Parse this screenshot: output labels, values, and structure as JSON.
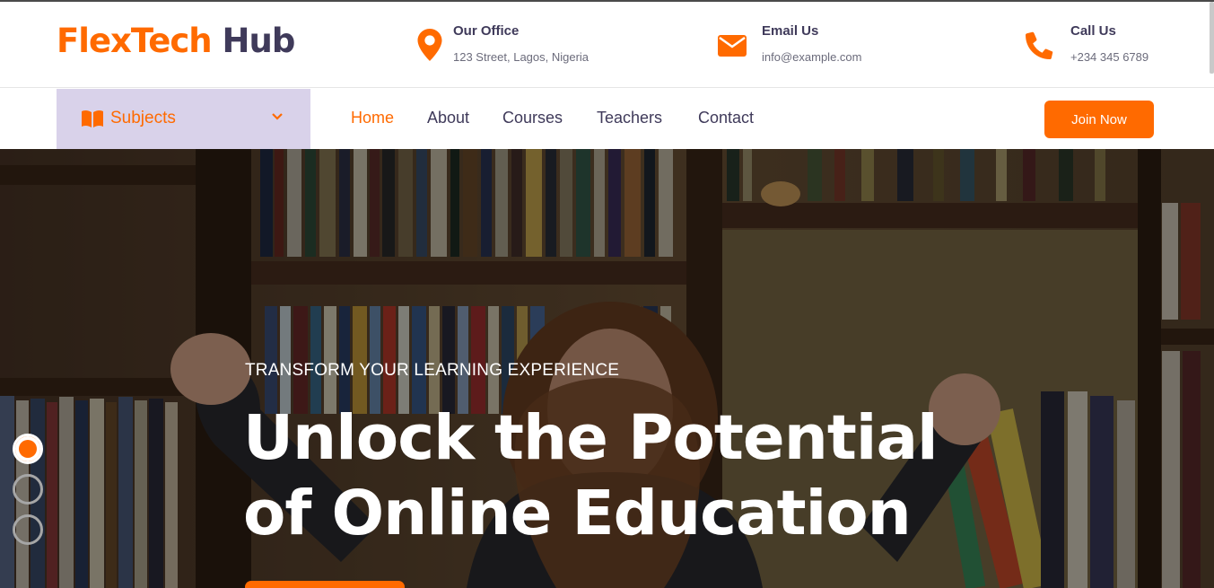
{
  "brand": {
    "part1": "FlexTech",
    "part2": "Hub"
  },
  "contact": [
    {
      "title": "Our Office",
      "detail": "123 Street, Lagos, Nigeria",
      "icon": "map-pin-icon"
    },
    {
      "title": "Email Us",
      "detail": "info@example.com",
      "icon": "envelope-icon"
    },
    {
      "title": "Call Us",
      "detail": "+234 345 6789",
      "icon": "phone-icon"
    }
  ],
  "nav": {
    "subjects_label": "Subjects",
    "items": [
      "Home",
      "About",
      "Courses",
      "Teachers",
      "Contact"
    ],
    "active": "Home",
    "join_label": "Join Now"
  },
  "hero": {
    "eyebrow": "TRANSFORM YOUR LEARNING EXPERIENCE",
    "headline_line1": "Unlock the Potential",
    "headline_line2": "of Online Education"
  },
  "carousel": {
    "slides": 3,
    "active_index": 0
  },
  "colors": {
    "accent": "#ff6a00",
    "dark": "#3f3a5a",
    "subjects_bg": "#d9d2ea"
  }
}
